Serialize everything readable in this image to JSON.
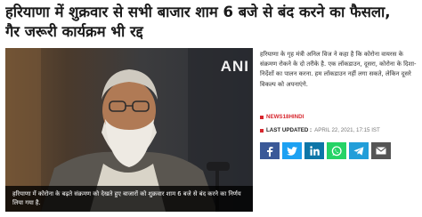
{
  "article": {
    "headline_line1": "हरियाणा में शुक्रवार से सभी बाजार शाम 6 बजे से बंद करने का फैसला,",
    "headline_line2": "गैर जरूरी कार्यक्रम भी रद्द",
    "summary": "हरियाणा के गृह मंत्री अनिल विज ने कहा है कि कोरोना वायरस के संक्रमण रोकने के दो तरीके है. एक लॉकडाउन, दूसरा, कोरोना के दिशा-निर्देशों का पालन करना. हम लॉकडाउन नहीं लगा सकते, लेकिन दूसरे विकल्प को अपनाएंगे.",
    "source": "NEWS18HINDI",
    "last_updated_label": "LAST UPDATED :",
    "last_updated_value": "APRIL 22, 2021, 17:15 IST"
  },
  "media": {
    "watermark": "ANI",
    "caption": "हरियाणा में कोरोना के बढ़ते संक्रमण को देखते हुए बाजारों को शुक्रवार शाम 6 बजे से बंद करने का निर्णय लिया गया है."
  },
  "share": [
    {
      "name": "facebook",
      "label": "f",
      "color": "#3b5998"
    },
    {
      "name": "twitter",
      "label": "t",
      "color": "#1da1f2"
    },
    {
      "name": "linkedin",
      "label": "in",
      "color": "#0e76a8"
    },
    {
      "name": "whatsapp",
      "label": "w",
      "color": "#25d366"
    },
    {
      "name": "telegram",
      "label": "tg",
      "color": "#229ed9"
    },
    {
      "name": "email",
      "label": "mail",
      "color": "#555555"
    }
  ],
  "colors": {
    "accent": "#d7262d"
  }
}
